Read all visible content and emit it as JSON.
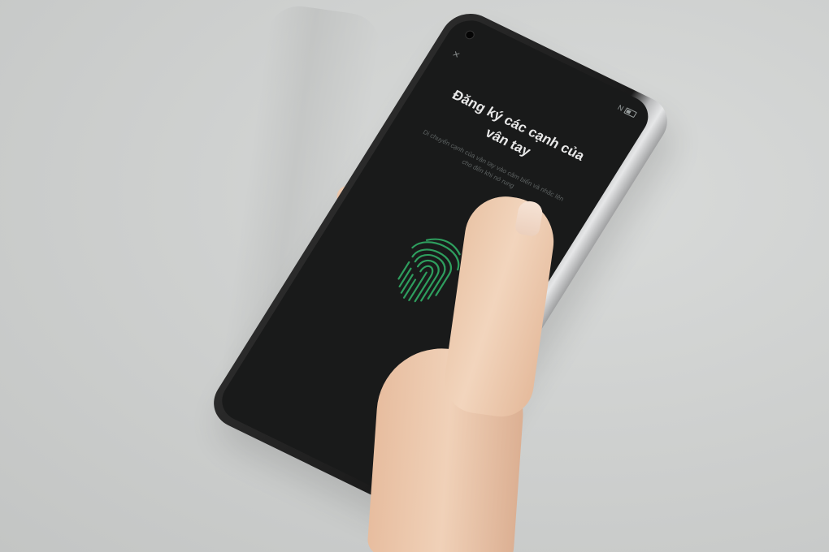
{
  "screen": {
    "title": "Đăng ký các cạnh của vân tay",
    "subtitle": "Di chuyển cạnh của vân tay vào cảm biến và nhấc lên cho đến khi nó rung",
    "close_label": "×",
    "status_indicator": "N"
  },
  "colors": {
    "background": "#cfd1d0",
    "screen": "#191a1a",
    "fingerprint": "#2e9e5e",
    "title": "#e8e8e8",
    "skin": "#f0d1b8"
  },
  "icons": {
    "close": "close-icon",
    "fingerprint": "fingerprint-icon",
    "battery": "battery-icon"
  }
}
